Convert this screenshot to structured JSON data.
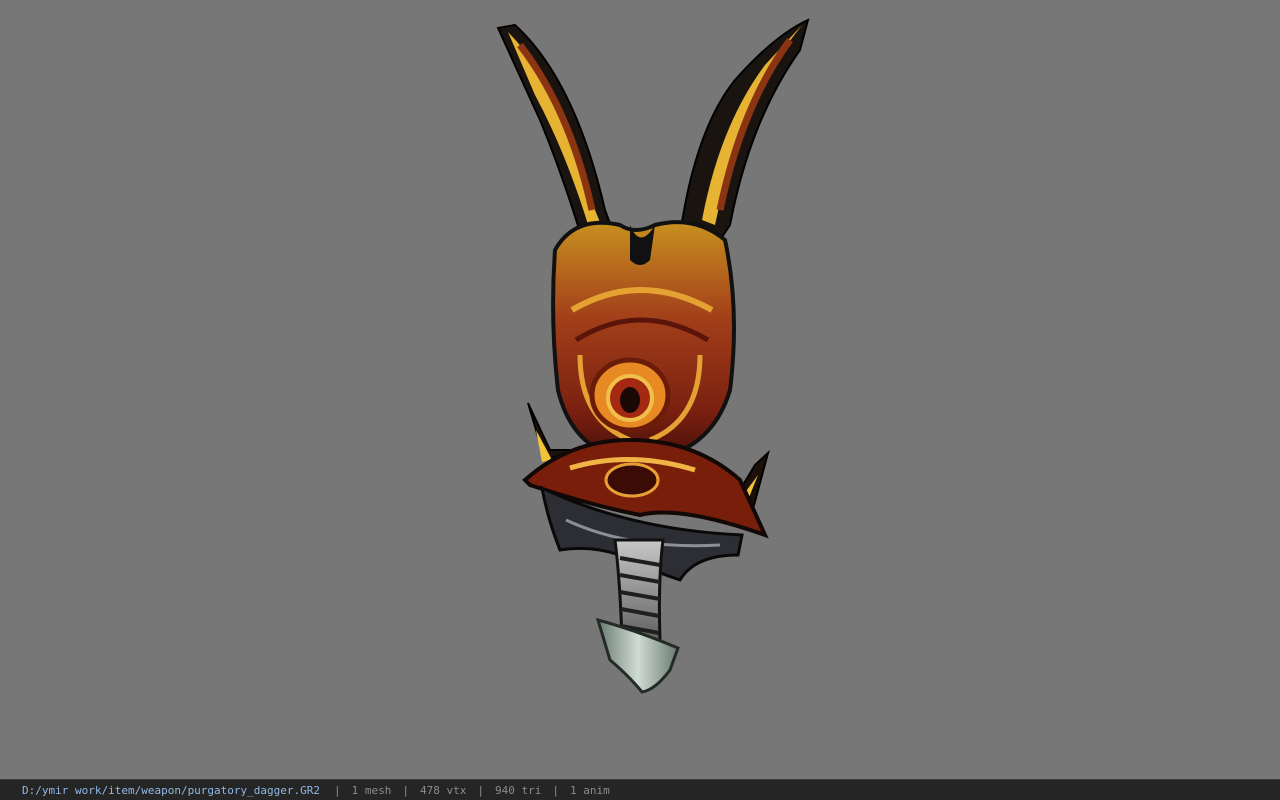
{
  "viewer": {
    "background_color": "#777777",
    "model_name": "purgatory_dagger"
  },
  "status": {
    "path": "D:/ymir work/item/weapon/purgatory_dagger.GR2",
    "separator": "|",
    "mesh": "1 mesh",
    "vertices": "478 vtx",
    "triangles": "940 tri",
    "anim": "1 anim"
  }
}
